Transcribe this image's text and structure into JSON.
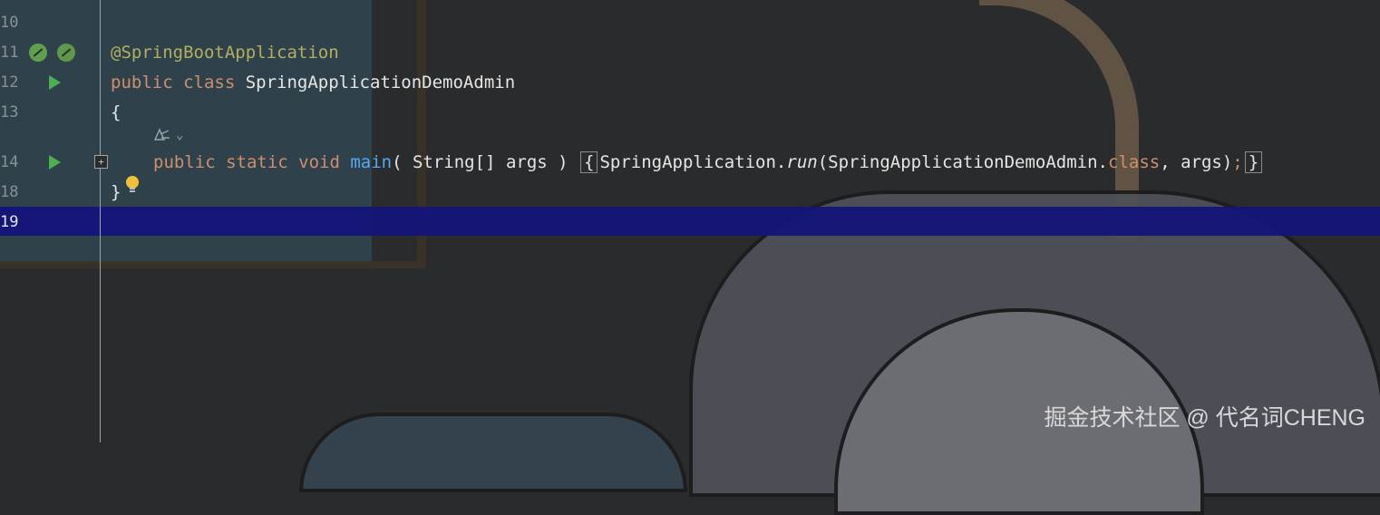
{
  "editor": {
    "lines": [
      {
        "num": "10"
      },
      {
        "num": "11",
        "text": "@SpringBootApplication"
      },
      {
        "num": "12",
        "kw1": "public class ",
        "text": "SpringApplicationDemoAdmin"
      },
      {
        "num": "13",
        "text": "{"
      },
      {
        "num": "14",
        "kw_mods": "public static void ",
        "fn": "main",
        "params": "( String[] args ) ",
        "lbrace": "{",
        "call_obj": "SpringApplication.",
        "call_fn": "run",
        "call_arg_open": "(SpringApplicationDemoAdmin.",
        "class_kw": "class",
        "call_rest": ", args)",
        "semi": ";",
        "rbrace": "}"
      },
      {
        "num": "18",
        "text": "}"
      },
      {
        "num": "19"
      }
    ],
    "gutter_icons": {
      "line11_left": "spring-bean-icon",
      "line11_right": "spring-run-icon",
      "line12": "run-icon",
      "line14": "run-icon",
      "line14_fold": "fold-expand-icon",
      "line18": "lightbulb-icon",
      "line13_hint": "ai-hint-icon"
    },
    "fold_glyph": "+",
    "hint_chevron": "⌄"
  },
  "watermark": "掘金技术社区 @ 代名词CHENG",
  "colors": {
    "background": "#2a2b2c",
    "keyword": "#cf8e6d",
    "annotation": "#b3ae60",
    "function": "#56a8f5",
    "text": "#e6e6e6",
    "current_line": "#14147a"
  }
}
